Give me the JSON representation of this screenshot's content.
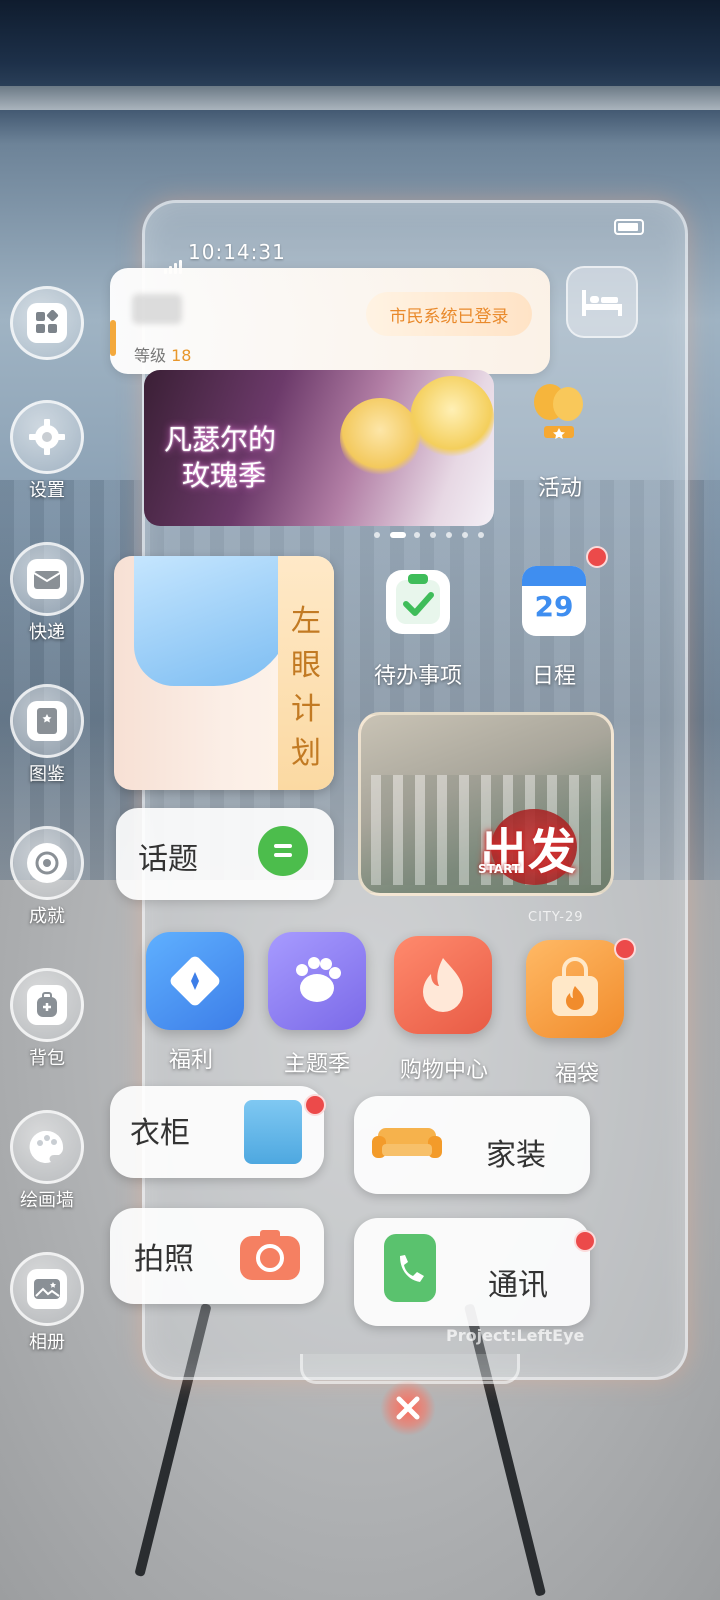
{
  "status": {
    "time": "10:14:31"
  },
  "sidebar": {
    "items": [
      {
        "label": "",
        "icon": "widgets-icon"
      },
      {
        "label": "设置",
        "icon": "gear-icon"
      },
      {
        "label": "快递",
        "icon": "parcel-icon"
      },
      {
        "label": "图鉴",
        "icon": "book-icon"
      },
      {
        "label": "成就",
        "icon": "medal-icon"
      },
      {
        "label": "背包",
        "icon": "backpack-icon"
      },
      {
        "label": "绘画墙",
        "icon": "palette-icon"
      },
      {
        "label": "相册",
        "icon": "album-icon"
      }
    ]
  },
  "user": {
    "level_label": "等级",
    "level_value": "18",
    "citizen_status": "市民系统已登录"
  },
  "banner": {
    "title_line1": "凡瑟尔的",
    "title_line2": "玫瑰季"
  },
  "activity": {
    "label": "活动"
  },
  "left_eye": {
    "label": "左眼计划"
  },
  "tiles": {
    "todo": "待办事项",
    "schedule": "日程",
    "calendar_day": "29",
    "topic": "话题",
    "start_big": "出发",
    "start_small": "START",
    "city_code": "CITY-29"
  },
  "apps": [
    {
      "label": "福利",
      "color": "#3d8ef0"
    },
    {
      "label": "主题季",
      "color": "#8a7af2"
    },
    {
      "label": "购物中心",
      "color": "#f0735a"
    },
    {
      "label": "福袋",
      "color": "#f4a14a"
    }
  ],
  "pills": {
    "wardrobe": "衣柜",
    "home": "家装",
    "photo": "拍照",
    "comm": "通讯"
  },
  "footer": {
    "project": "Project:LeftEye"
  },
  "colors": {
    "accent": "#f3a93d",
    "badge": "#ec4a4a"
  }
}
